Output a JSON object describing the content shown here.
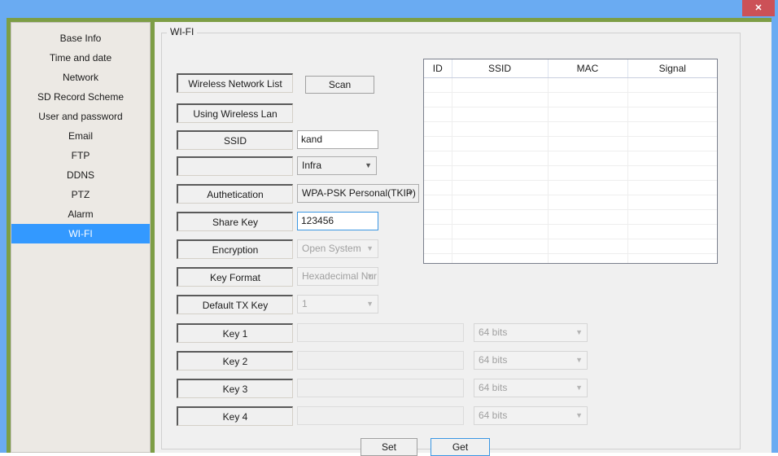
{
  "window": {
    "close_label": "✕"
  },
  "sidebar": {
    "items": [
      {
        "label": "Base Info",
        "selected": false
      },
      {
        "label": "Time and date",
        "selected": false
      },
      {
        "label": "Network",
        "selected": false
      },
      {
        "label": "SD Record Scheme",
        "selected": false
      },
      {
        "label": "User and password",
        "selected": false
      },
      {
        "label": "Email",
        "selected": false
      },
      {
        "label": "FTP",
        "selected": false
      },
      {
        "label": "DDNS",
        "selected": false
      },
      {
        "label": "PTZ",
        "selected": false
      },
      {
        "label": "Alarm",
        "selected": false
      },
      {
        "label": "WI-FI",
        "selected": true
      }
    ],
    "selected_label": "WI-FI",
    "highlight_color": "#3399ff"
  },
  "group": {
    "legend": "WI-FI"
  },
  "form": {
    "wireless_network_list_label": "Wireless Network List",
    "scan_label": "Scan",
    "using_wireless_lan_label": "Using Wireless Lan",
    "using_wireless_lan_checked": true,
    "ssid_label": "SSID",
    "ssid_value": "kand",
    "mode_label": "",
    "mode_value": "Infra",
    "authentication_label": "Authetication",
    "authentication_value": "WPA-PSK Personal(TKIP)",
    "share_key_label": "Share Key",
    "share_key_value": "123456",
    "encryption_label": "Encryption",
    "encryption_value": "Open System",
    "encryption_disabled": true,
    "key_format_label": "Key Format",
    "key_format_value": "Hexadecimal Nur",
    "key_format_disabled": true,
    "default_tx_key_label": "Default TX Key",
    "default_tx_key_value": "1",
    "default_tx_key_disabled": true,
    "keys": [
      {
        "label": "Key 1",
        "value": "",
        "bits": "64 bits"
      },
      {
        "label": "Key 2",
        "value": "",
        "bits": "64 bits"
      },
      {
        "label": "Key 3",
        "value": "",
        "bits": "64 bits"
      },
      {
        "label": "Key 4",
        "value": "",
        "bits": "64 bits"
      }
    ],
    "set_label": "Set",
    "get_label": "Get"
  },
  "table": {
    "columns": [
      "ID",
      "SSID",
      "MAC",
      "Signal"
    ],
    "rows": [],
    "empty_row_count": 13
  },
  "colors": {
    "title_bar": "#6aabf2",
    "client_border": "#7d9e46",
    "sidebar_bg": "#ece9e4",
    "panel_bg": "#f0f0f0",
    "close_button": "#cc5157",
    "focus_blue": "#3b97e3"
  },
  "icons": {
    "close": "close-icon",
    "chevron_down": "chevron-down-icon",
    "check": "check-icon"
  }
}
